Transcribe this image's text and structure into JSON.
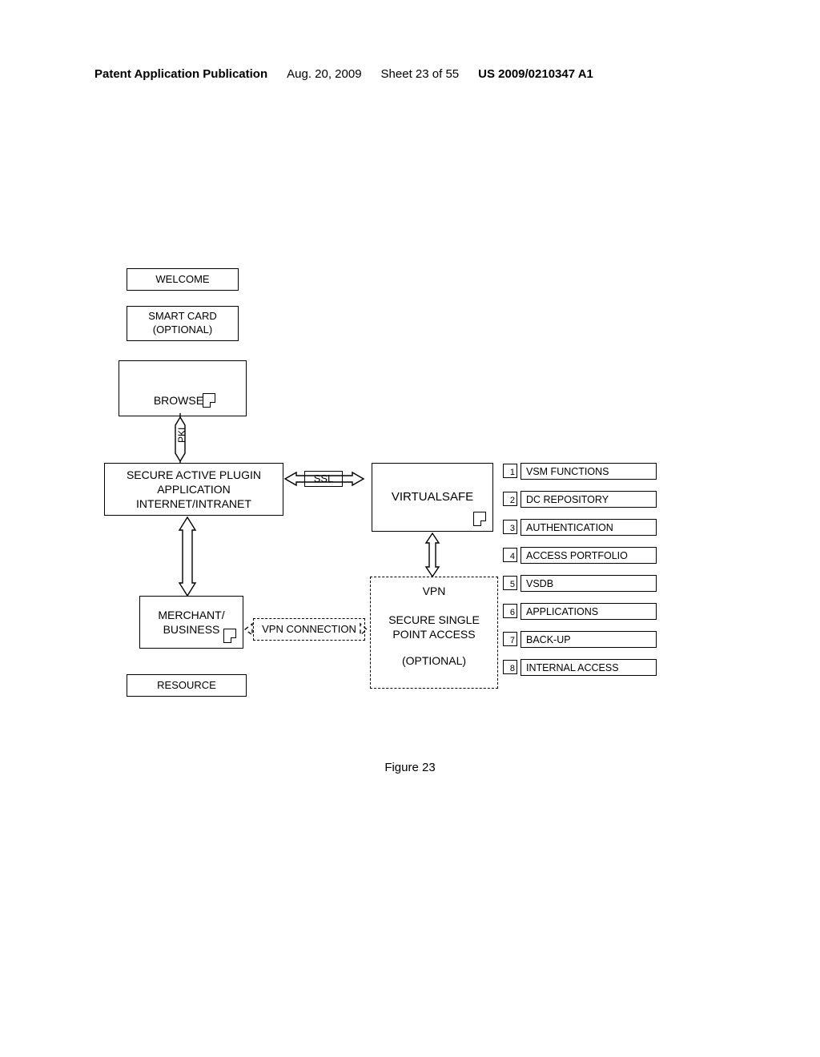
{
  "header": {
    "type_line": "Patent Application Publication",
    "date": "Aug. 20, 2009",
    "sheet": "Sheet 23 of 55",
    "pubno": "US 2009/0210347 A1"
  },
  "figure_caption": "Figure 23",
  "boxes": {
    "welcome": "WELCOME",
    "smartcard_l1": "SMART CARD",
    "smartcard_l2": "(OPTIONAL)",
    "browser": "BROWSER",
    "pki": "PKI",
    "plugin_l1": "SECURE ACTIVE PLUGIN",
    "plugin_l2": "APPLICATION",
    "plugin_l3": "INTERNET/INTRANET",
    "ssl": "SSL",
    "virtualsafe": "VIRTUALSAFE",
    "merchant_l1": "MERCHANT/",
    "merchant_l2": "BUSINESS",
    "vpn_conn": "VPN CONNECTION",
    "resource": "RESOURCE",
    "vpn": "VPN",
    "sspa_l1": "SECURE SINGLE",
    "sspa_l2": "POINT ACCESS",
    "sspa_l3": "(OPTIONAL)"
  },
  "list": [
    {
      "n": "1",
      "label": "VSM FUNCTIONS"
    },
    {
      "n": "2",
      "label": "DC REPOSITORY"
    },
    {
      "n": "3",
      "label": "AUTHENTICATION"
    },
    {
      "n": "4",
      "label": "ACCESS PORTFOLIO"
    },
    {
      "n": "5",
      "label": "VSDB"
    },
    {
      "n": "6",
      "label": "APPLICATIONS"
    },
    {
      "n": "7",
      "label": "BACK-UP"
    },
    {
      "n": "8",
      "label": "INTERNAL ACCESS"
    }
  ]
}
